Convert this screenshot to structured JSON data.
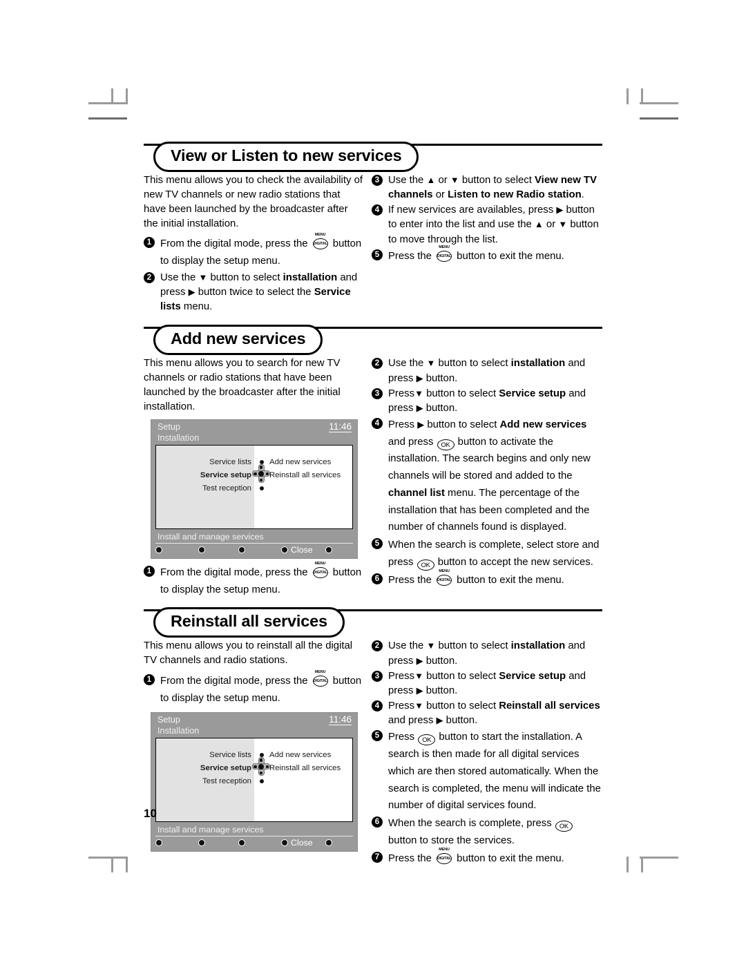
{
  "page": {
    "number": "10"
  },
  "sections": [
    {
      "title": "View or Listen to new  services",
      "intro": "This menu allows you to check the availability of new TV channels or new radio stations that have been launched by the broadcaster after the initial installation.",
      "left_steps": [
        {
          "n": "1",
          "html": "From the digital mode, press the <MENU> button to display the setup menu."
        },
        {
          "n": "2",
          "html": "Use the ▼ button to select <b>installation</b> and press ▶ button twice to select the <b>Service lists</b> menu."
        }
      ],
      "right_steps": [
        {
          "n": "3",
          "html": "Use the ▲ or ▼ button to select <b>View new TV channels</b> or <b>Listen to new Radio station</b>."
        },
        {
          "n": "4",
          "html": "If new services are availables, press ▶ button to enter into the list and use the ▲ or ▼ button to move through the list."
        },
        {
          "n": "5",
          "html": "Press the <MENU> button to exit the menu."
        }
      ]
    },
    {
      "title": "Add new services",
      "intro": "This menu allows you to search for new TV channels or radio stations that have been launched by the broadcaster after the initial installation.",
      "left_steps": [
        {
          "n": "1",
          "html": "From the digital mode, press the <MENU> button to display the setup menu."
        }
      ],
      "right_steps": [
        {
          "n": "2",
          "html": "Use the ▼ button to select <b>installation</b> and press ▶ button."
        },
        {
          "n": "3",
          "html": "Press▼ button to select <b>Service setup</b> and press ▶  button."
        },
        {
          "n": "4",
          "html": "Press ▶ button to select <b>Add new services</b> and press <OK> button to activate the installation. The search begins and only new channels will be stored and added to the <b>channel list</b> menu. The percentage of the installation that has been completed and the number of channels found is displayed."
        },
        {
          "n": "5",
          "html": "When the search is complete, select store and press <OK> button to accept the new services."
        },
        {
          "n": "6",
          "html": "Press the <MENU> button to exit the menu."
        }
      ]
    },
    {
      "title": "Reinstall all services",
      "intro": "This menu allows you to reinstall all the digital TV channels and radio stations.",
      "left_steps": [
        {
          "n": "1",
          "html": "From the digital mode, press the <MENU> button to display the setup menu."
        }
      ],
      "right_steps": [
        {
          "n": "2",
          "html": "Use the ▼ button to select <b>installation</b> and press ▶ button."
        },
        {
          "n": "3",
          "html": "Press▼ button to select <b>Service setup</b> and press ▶  button."
        },
        {
          "n": "4",
          "html": "Press▼ button to select <b>Reinstall all services</b> and press ▶  button."
        },
        {
          "n": "5",
          "html": "Press <OK> button to start the installation. A search is then made for all digital services which are then stored automatically. When the search is completed, the menu will indicate the number of digital services found."
        },
        {
          "n": "6",
          "html": "When the search is complete, press <OK> button to store the services."
        },
        {
          "n": "7",
          "html": "Press the <MENU> button to exit the menu."
        }
      ]
    }
  ],
  "tv_screen": {
    "title": "Setup",
    "time": "11:46",
    "subtitle": "Installation",
    "menu_left": [
      {
        "label": "Service lists",
        "selected": false
      },
      {
        "label": "Service setup",
        "selected": true
      },
      {
        "label": "Test reception",
        "selected": false
      }
    ],
    "menu_right": [
      "Add new services",
      "Reinstall all services"
    ],
    "footer": "Install and manage services",
    "buttons": [
      "",
      "",
      "",
      "Close",
      ""
    ]
  },
  "icons": {
    "menu_top_label": "MENU",
    "menu_circle_label": "DIGITAL",
    "ok_label": "OK",
    "dpad": "dpad-icon"
  }
}
